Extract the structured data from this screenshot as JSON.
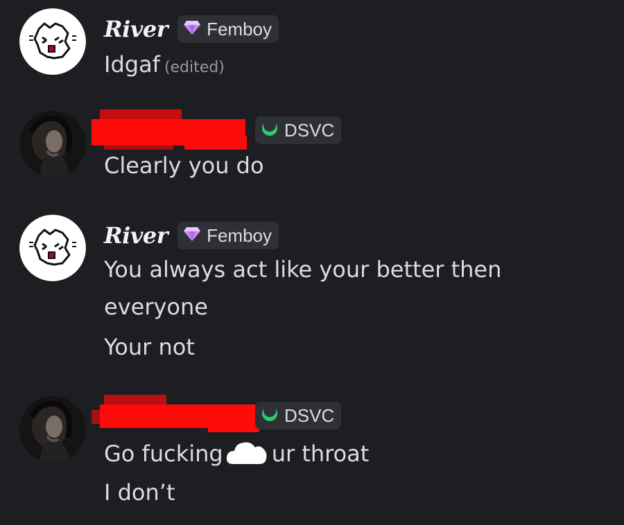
{
  "messages": [
    {
      "username": "River",
      "tag": "Femboy",
      "tag_icon": "diamond-gem-icon",
      "lines": [
        "Idgaf"
      ],
      "edited_label": "(edited)"
    },
    {
      "username": "",
      "username_redacted": true,
      "tag": "DSVC",
      "tag_icon": "crescent-moon-icon",
      "lines": [
        "Clearly you do"
      ]
    },
    {
      "username": "River",
      "tag": "Femboy",
      "tag_icon": "diamond-gem-icon",
      "lines": [
        "You always act like your better then",
        "everyone",
        "Your not"
      ]
    },
    {
      "username": "",
      "username_redacted": true,
      "tag": "DSVC",
      "tag_icon": "crescent-moon-icon",
      "lines": [
        {
          "before": "Go fucking",
          "emoji": "cloud-emoji",
          "after": "ur throat"
        },
        "I don’t"
      ]
    }
  ],
  "colors": {
    "background": "#1d1e22",
    "text": "#dcdde1",
    "tag_background": "#2e3036",
    "redaction": "#ff0a0a",
    "gem": "#c58bf2",
    "moon": "#2ecc71"
  }
}
